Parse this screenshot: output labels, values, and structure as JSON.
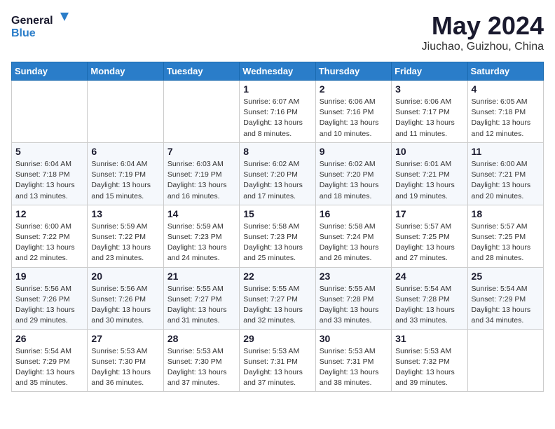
{
  "header": {
    "logo": {
      "line1": "General",
      "line2": "Blue"
    },
    "title": "May 2024",
    "subtitle": "Jiuchao, Guizhou, China"
  },
  "weekdays": [
    "Sunday",
    "Monday",
    "Tuesday",
    "Wednesday",
    "Thursday",
    "Friday",
    "Saturday"
  ],
  "weeks": [
    [
      {
        "day": "",
        "lines": []
      },
      {
        "day": "",
        "lines": []
      },
      {
        "day": "",
        "lines": []
      },
      {
        "day": "1",
        "lines": [
          "Sunrise: 6:07 AM",
          "Sunset: 7:16 PM",
          "Daylight: 13 hours",
          "and 8 minutes."
        ]
      },
      {
        "day": "2",
        "lines": [
          "Sunrise: 6:06 AM",
          "Sunset: 7:16 PM",
          "Daylight: 13 hours",
          "and 10 minutes."
        ]
      },
      {
        "day": "3",
        "lines": [
          "Sunrise: 6:06 AM",
          "Sunset: 7:17 PM",
          "Daylight: 13 hours",
          "and 11 minutes."
        ]
      },
      {
        "day": "4",
        "lines": [
          "Sunrise: 6:05 AM",
          "Sunset: 7:18 PM",
          "Daylight: 13 hours",
          "and 12 minutes."
        ]
      }
    ],
    [
      {
        "day": "5",
        "lines": [
          "Sunrise: 6:04 AM",
          "Sunset: 7:18 PM",
          "Daylight: 13 hours",
          "and 13 minutes."
        ]
      },
      {
        "day": "6",
        "lines": [
          "Sunrise: 6:04 AM",
          "Sunset: 7:19 PM",
          "Daylight: 13 hours",
          "and 15 minutes."
        ]
      },
      {
        "day": "7",
        "lines": [
          "Sunrise: 6:03 AM",
          "Sunset: 7:19 PM",
          "Daylight: 13 hours",
          "and 16 minutes."
        ]
      },
      {
        "day": "8",
        "lines": [
          "Sunrise: 6:02 AM",
          "Sunset: 7:20 PM",
          "Daylight: 13 hours",
          "and 17 minutes."
        ]
      },
      {
        "day": "9",
        "lines": [
          "Sunrise: 6:02 AM",
          "Sunset: 7:20 PM",
          "Daylight: 13 hours",
          "and 18 minutes."
        ]
      },
      {
        "day": "10",
        "lines": [
          "Sunrise: 6:01 AM",
          "Sunset: 7:21 PM",
          "Daylight: 13 hours",
          "and 19 minutes."
        ]
      },
      {
        "day": "11",
        "lines": [
          "Sunrise: 6:00 AM",
          "Sunset: 7:21 PM",
          "Daylight: 13 hours",
          "and 20 minutes."
        ]
      }
    ],
    [
      {
        "day": "12",
        "lines": [
          "Sunrise: 6:00 AM",
          "Sunset: 7:22 PM",
          "Daylight: 13 hours",
          "and 22 minutes."
        ]
      },
      {
        "day": "13",
        "lines": [
          "Sunrise: 5:59 AM",
          "Sunset: 7:22 PM",
          "Daylight: 13 hours",
          "and 23 minutes."
        ]
      },
      {
        "day": "14",
        "lines": [
          "Sunrise: 5:59 AM",
          "Sunset: 7:23 PM",
          "Daylight: 13 hours",
          "and 24 minutes."
        ]
      },
      {
        "day": "15",
        "lines": [
          "Sunrise: 5:58 AM",
          "Sunset: 7:23 PM",
          "Daylight: 13 hours",
          "and 25 minutes."
        ]
      },
      {
        "day": "16",
        "lines": [
          "Sunrise: 5:58 AM",
          "Sunset: 7:24 PM",
          "Daylight: 13 hours",
          "and 26 minutes."
        ]
      },
      {
        "day": "17",
        "lines": [
          "Sunrise: 5:57 AM",
          "Sunset: 7:25 PM",
          "Daylight: 13 hours",
          "and 27 minutes."
        ]
      },
      {
        "day": "18",
        "lines": [
          "Sunrise: 5:57 AM",
          "Sunset: 7:25 PM",
          "Daylight: 13 hours",
          "and 28 minutes."
        ]
      }
    ],
    [
      {
        "day": "19",
        "lines": [
          "Sunrise: 5:56 AM",
          "Sunset: 7:26 PM",
          "Daylight: 13 hours",
          "and 29 minutes."
        ]
      },
      {
        "day": "20",
        "lines": [
          "Sunrise: 5:56 AM",
          "Sunset: 7:26 PM",
          "Daylight: 13 hours",
          "and 30 minutes."
        ]
      },
      {
        "day": "21",
        "lines": [
          "Sunrise: 5:55 AM",
          "Sunset: 7:27 PM",
          "Daylight: 13 hours",
          "and 31 minutes."
        ]
      },
      {
        "day": "22",
        "lines": [
          "Sunrise: 5:55 AM",
          "Sunset: 7:27 PM",
          "Daylight: 13 hours",
          "and 32 minutes."
        ]
      },
      {
        "day": "23",
        "lines": [
          "Sunrise: 5:55 AM",
          "Sunset: 7:28 PM",
          "Daylight: 13 hours",
          "and 33 minutes."
        ]
      },
      {
        "day": "24",
        "lines": [
          "Sunrise: 5:54 AM",
          "Sunset: 7:28 PM",
          "Daylight: 13 hours",
          "and 33 minutes."
        ]
      },
      {
        "day": "25",
        "lines": [
          "Sunrise: 5:54 AM",
          "Sunset: 7:29 PM",
          "Daylight: 13 hours",
          "and 34 minutes."
        ]
      }
    ],
    [
      {
        "day": "26",
        "lines": [
          "Sunrise: 5:54 AM",
          "Sunset: 7:29 PM",
          "Daylight: 13 hours",
          "and 35 minutes."
        ]
      },
      {
        "day": "27",
        "lines": [
          "Sunrise: 5:53 AM",
          "Sunset: 7:30 PM",
          "Daylight: 13 hours",
          "and 36 minutes."
        ]
      },
      {
        "day": "28",
        "lines": [
          "Sunrise: 5:53 AM",
          "Sunset: 7:30 PM",
          "Daylight: 13 hours",
          "and 37 minutes."
        ]
      },
      {
        "day": "29",
        "lines": [
          "Sunrise: 5:53 AM",
          "Sunset: 7:31 PM",
          "Daylight: 13 hours",
          "and 37 minutes."
        ]
      },
      {
        "day": "30",
        "lines": [
          "Sunrise: 5:53 AM",
          "Sunset: 7:31 PM",
          "Daylight: 13 hours",
          "and 38 minutes."
        ]
      },
      {
        "day": "31",
        "lines": [
          "Sunrise: 5:53 AM",
          "Sunset: 7:32 PM",
          "Daylight: 13 hours",
          "and 39 minutes."
        ]
      },
      {
        "day": "",
        "lines": []
      }
    ]
  ]
}
